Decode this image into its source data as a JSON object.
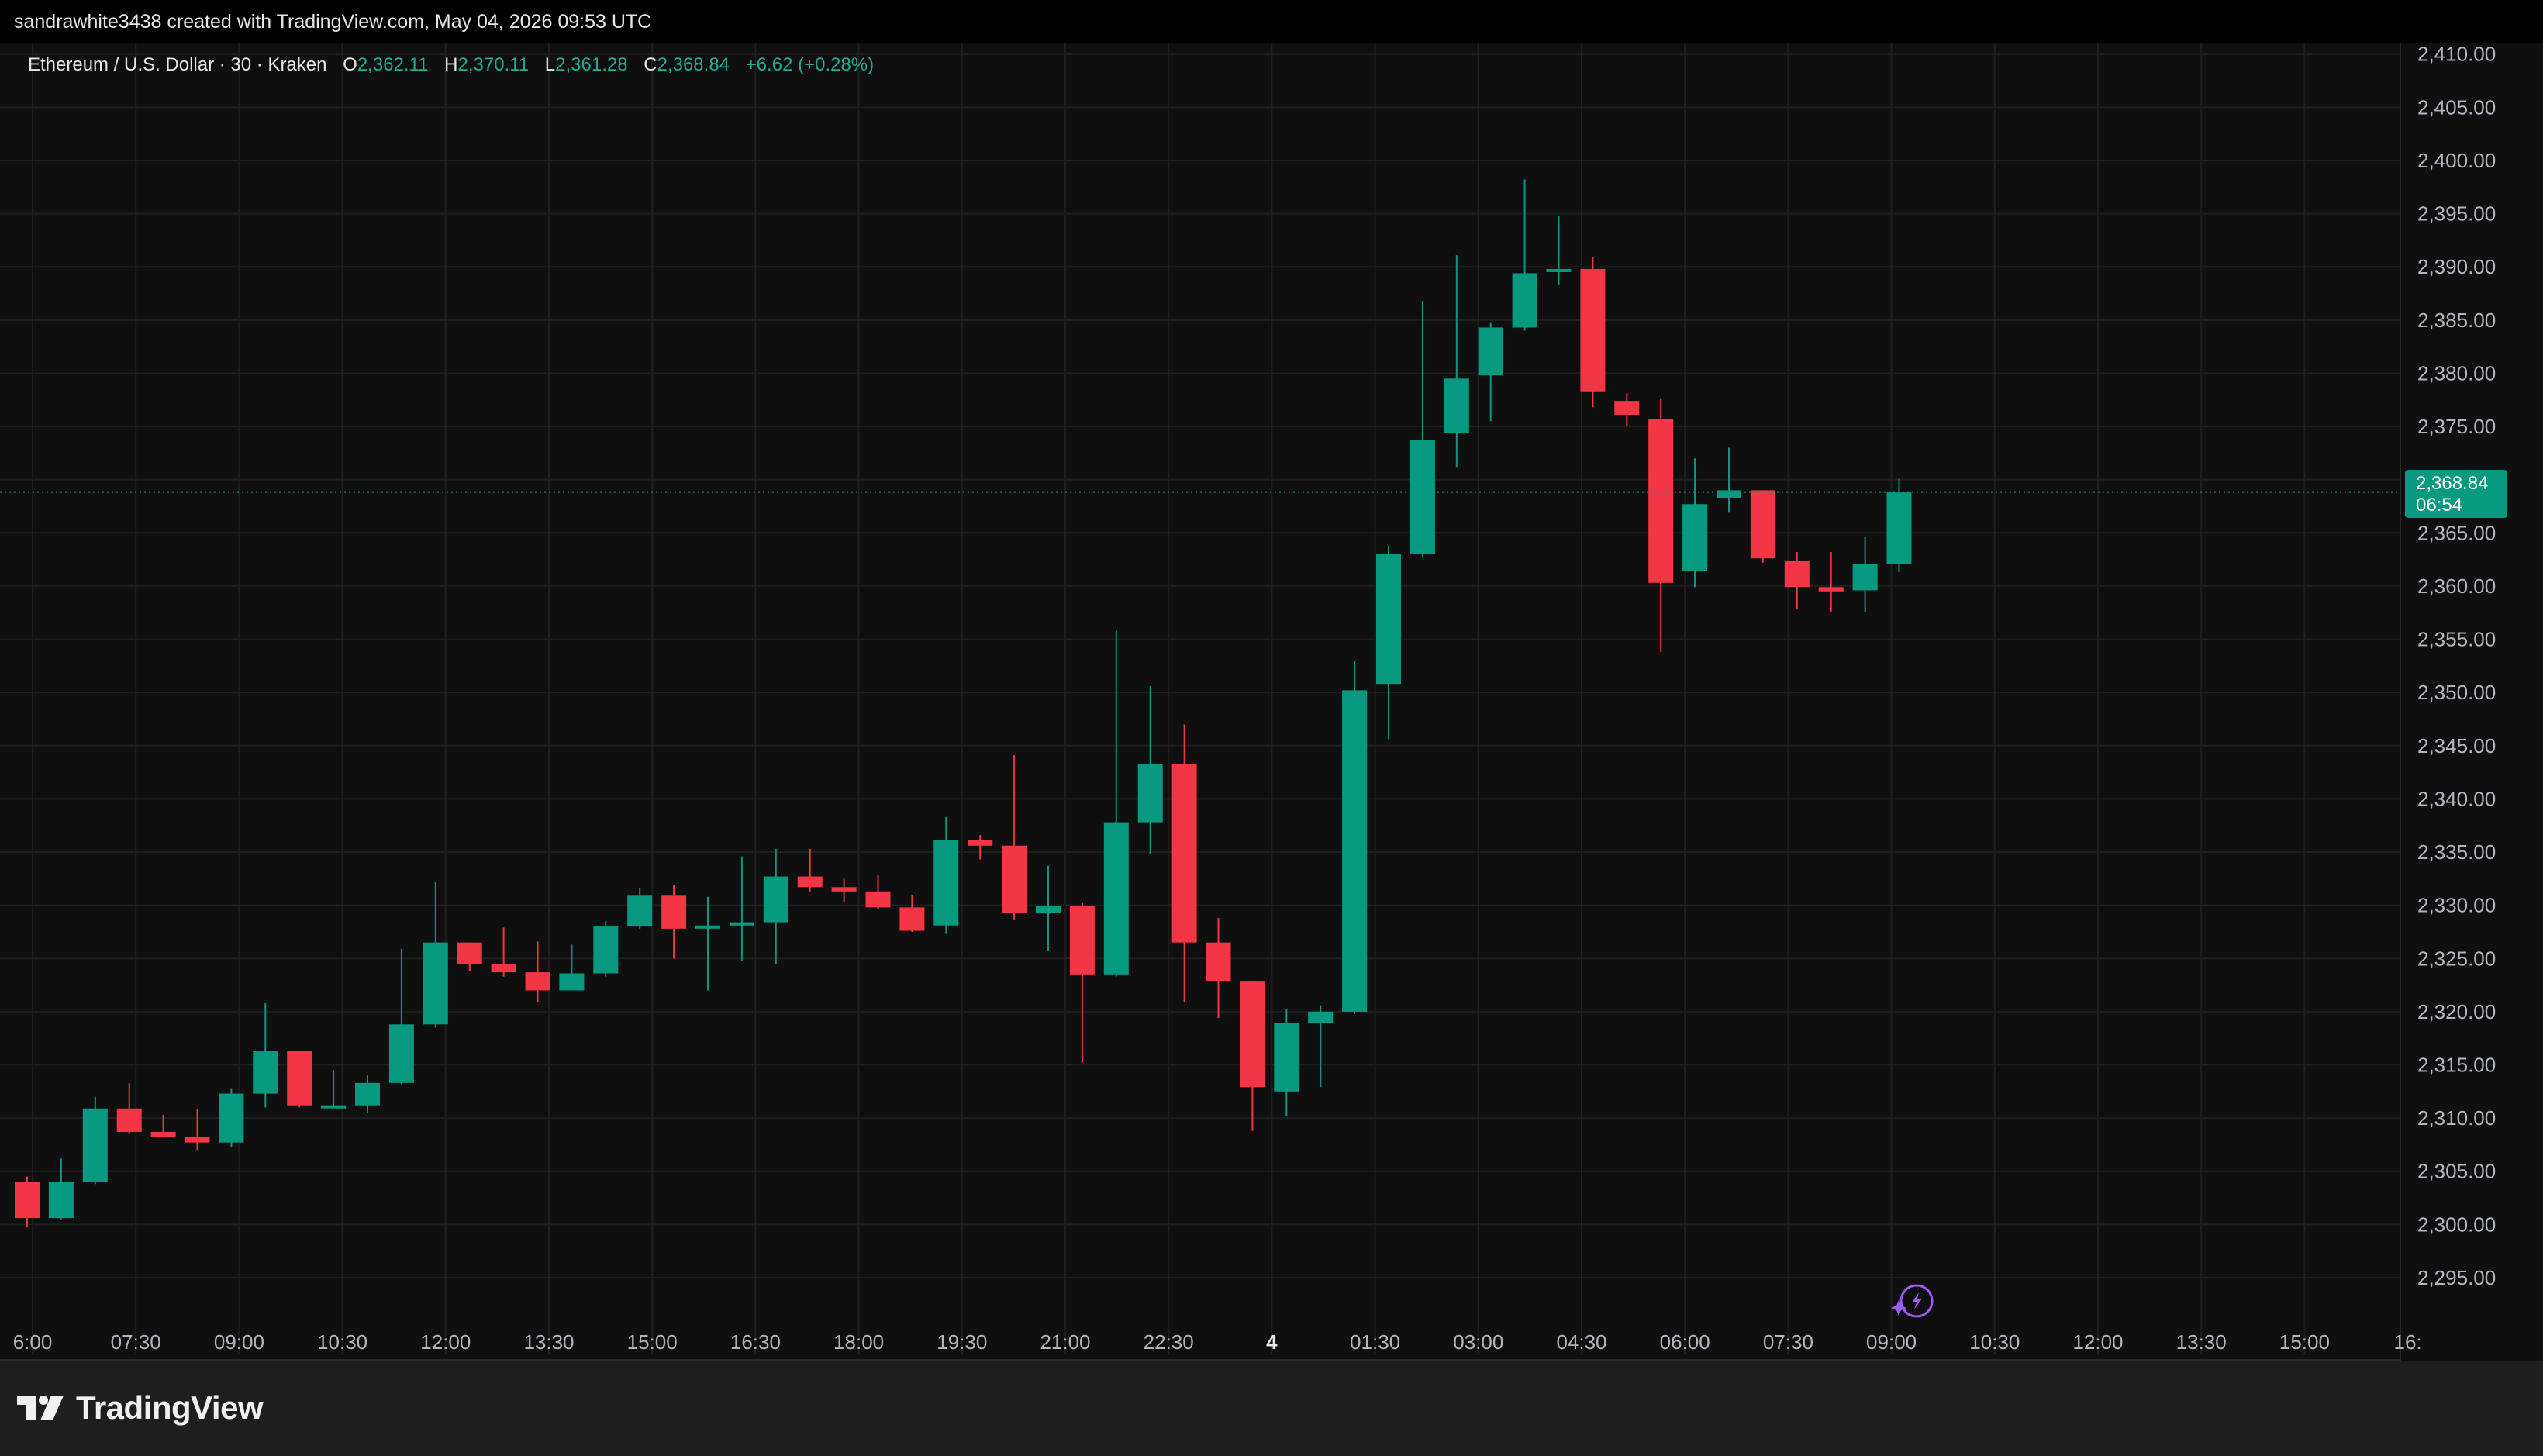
{
  "credit": "sandrawhite3438 created with TradingView.com, May 04, 2026 09:53 UTC",
  "legend": {
    "symbol": "Ethereum / U.S. Dollar · 30 · Kraken",
    "o_label": "O",
    "o": "2,362.11",
    "h_label": "H",
    "h": "2,370.11",
    "l_label": "L",
    "l": "2,361.28",
    "c_label": "C",
    "c": "2,368.84",
    "change": "+6.62 (+0.28%)"
  },
  "price_tag": {
    "price": "2,368.84",
    "countdown": "06:54"
  },
  "brand": "TradingView",
  "colors": {
    "up": "#089981",
    "down": "#f23645",
    "bg": "#0f0f0f",
    "grid": "#1e1e1e",
    "text": "#b2b5be"
  },
  "chart_data": {
    "type": "candlestick",
    "title": "Ethereum / U.S. Dollar · 30 · Kraken",
    "interval_minutes": 30,
    "first_candle_time": "2026-05-03 06:00",
    "ylim": [
      2291.5,
      2411
    ],
    "ygrid_step": 5,
    "grid": true,
    "last_price": 2368.84,
    "x_tick_labels": [
      "6:00",
      "07:30",
      "09:00",
      "10:30",
      "12:00",
      "13:30",
      "15:00",
      "16:30",
      "18:00",
      "19:30",
      "21:00",
      "22:30",
      "4",
      "01:30",
      "03:00",
      "04:30",
      "06:00",
      "07:30",
      "09:00",
      "10:30",
      "12:00",
      "13:30",
      "15:00",
      "16:"
    ],
    "y_tick_labels": [
      "2,410.00",
      "2,405.00",
      "2,400.00",
      "2,395.00",
      "2,390.00",
      "2,385.00",
      "2,380.00",
      "2,375.00",
      "2,370.00",
      "2,365.00",
      "2,360.00",
      "2,355.00",
      "2,350.00",
      "2,345.00",
      "2,340.00",
      "2,335.00",
      "2,330.00",
      "2,325.00",
      "2,320.00",
      "2,315.00",
      "2,310.00",
      "2,305.00",
      "2,300.00",
      "2,295.00"
    ],
    "candles": [
      [
        2304.0,
        2304.5,
        2299.8,
        2300.6
      ],
      [
        2300.6,
        2306.2,
        2300.5,
        2304.0
      ],
      [
        2304.0,
        2312.0,
        2303.8,
        2310.9
      ],
      [
        2310.9,
        2313.3,
        2308.5,
        2308.7
      ],
      [
        2308.7,
        2310.3,
        2308.2,
        2308.2
      ],
      [
        2308.2,
        2310.8,
        2307.0,
        2307.7
      ],
      [
        2307.7,
        2312.8,
        2307.3,
        2312.3
      ],
      [
        2312.3,
        2320.8,
        2311.0,
        2316.3
      ],
      [
        2316.3,
        2316.3,
        2311.0,
        2311.2
      ],
      [
        2311.2,
        2314.5,
        2311.0,
        2311.2
      ],
      [
        2311.2,
        2314.0,
        2310.5,
        2313.3
      ],
      [
        2313.3,
        2325.9,
        2313.2,
        2318.8
      ],
      [
        2318.8,
        2332.2,
        2318.5,
        2326.5
      ],
      [
        2326.5,
        2326.5,
        2323.8,
        2324.5
      ],
      [
        2324.5,
        2327.9,
        2323.3,
        2323.7
      ],
      [
        2323.7,
        2326.6,
        2320.9,
        2322.0
      ],
      [
        2322.0,
        2326.3,
        2322.0,
        2323.6
      ],
      [
        2323.6,
        2328.5,
        2323.3,
        2328.0
      ],
      [
        2328.0,
        2331.6,
        2327.8,
        2330.9
      ],
      [
        2330.9,
        2331.9,
        2325.0,
        2327.8
      ],
      [
        2327.8,
        2330.8,
        2322.0,
        2328.1
      ],
      [
        2328.1,
        2334.6,
        2324.8,
        2328.4
      ],
      [
        2328.4,
        2335.3,
        2324.5,
        2332.7
      ],
      [
        2332.7,
        2335.3,
        2331.3,
        2331.7
      ],
      [
        2331.7,
        2332.5,
        2330.3,
        2331.3
      ],
      [
        2331.3,
        2332.8,
        2329.6,
        2329.8
      ],
      [
        2329.8,
        2331.0,
        2327.5,
        2327.6
      ],
      [
        2328.1,
        2338.3,
        2327.3,
        2336.1
      ],
      [
        2336.1,
        2336.6,
        2334.3,
        2335.6
      ],
      [
        2335.6,
        2344.1,
        2328.6,
        2329.3
      ],
      [
        2329.3,
        2333.7,
        2325.7,
        2329.9
      ],
      [
        2329.9,
        2330.2,
        2315.2,
        2323.5
      ],
      [
        2323.5,
        2355.8,
        2323.3,
        2337.8
      ],
      [
        2337.8,
        2350.6,
        2334.8,
        2343.3
      ],
      [
        2343.3,
        2347.0,
        2320.9,
        2326.5
      ],
      [
        2326.5,
        2328.8,
        2319.4,
        2322.9
      ],
      [
        2322.9,
        2322.9,
        2308.8,
        2312.9
      ],
      [
        2312.5,
        2320.2,
        2310.2,
        2318.9
      ],
      [
        2318.9,
        2320.6,
        2312.9,
        2320.0
      ],
      [
        2320.0,
        2353.0,
        2319.8,
        2350.2
      ],
      [
        2350.8,
        2363.8,
        2345.6,
        2363.0
      ],
      [
        2363.0,
        2386.8,
        2362.7,
        2373.7
      ],
      [
        2374.4,
        2391.1,
        2371.2,
        2379.5
      ],
      [
        2379.8,
        2384.8,
        2375.5,
        2384.3
      ],
      [
        2384.3,
        2398.2,
        2384.0,
        2389.4
      ],
      [
        2389.8,
        2394.8,
        2388.3,
        2389.8
      ],
      [
        2389.8,
        2390.9,
        2376.8,
        2378.3
      ],
      [
        2377.4,
        2378.1,
        2375.0,
        2376.1
      ],
      [
        2375.7,
        2377.6,
        2353.8,
        2360.3
      ],
      [
        2361.4,
        2372.0,
        2359.9,
        2367.7
      ],
      [
        2368.3,
        2373.0,
        2366.9,
        2369.0
      ],
      [
        2369.0,
        2369.0,
        2362.2,
        2362.6
      ],
      [
        2362.4,
        2363.2,
        2357.8,
        2359.9
      ],
      [
        2359.9,
        2363.2,
        2357.6,
        2359.5
      ],
      [
        2359.6,
        2364.6,
        2357.6,
        2362.1
      ],
      [
        2362.1,
        2370.1,
        2361.3,
        2368.8
      ]
    ]
  }
}
